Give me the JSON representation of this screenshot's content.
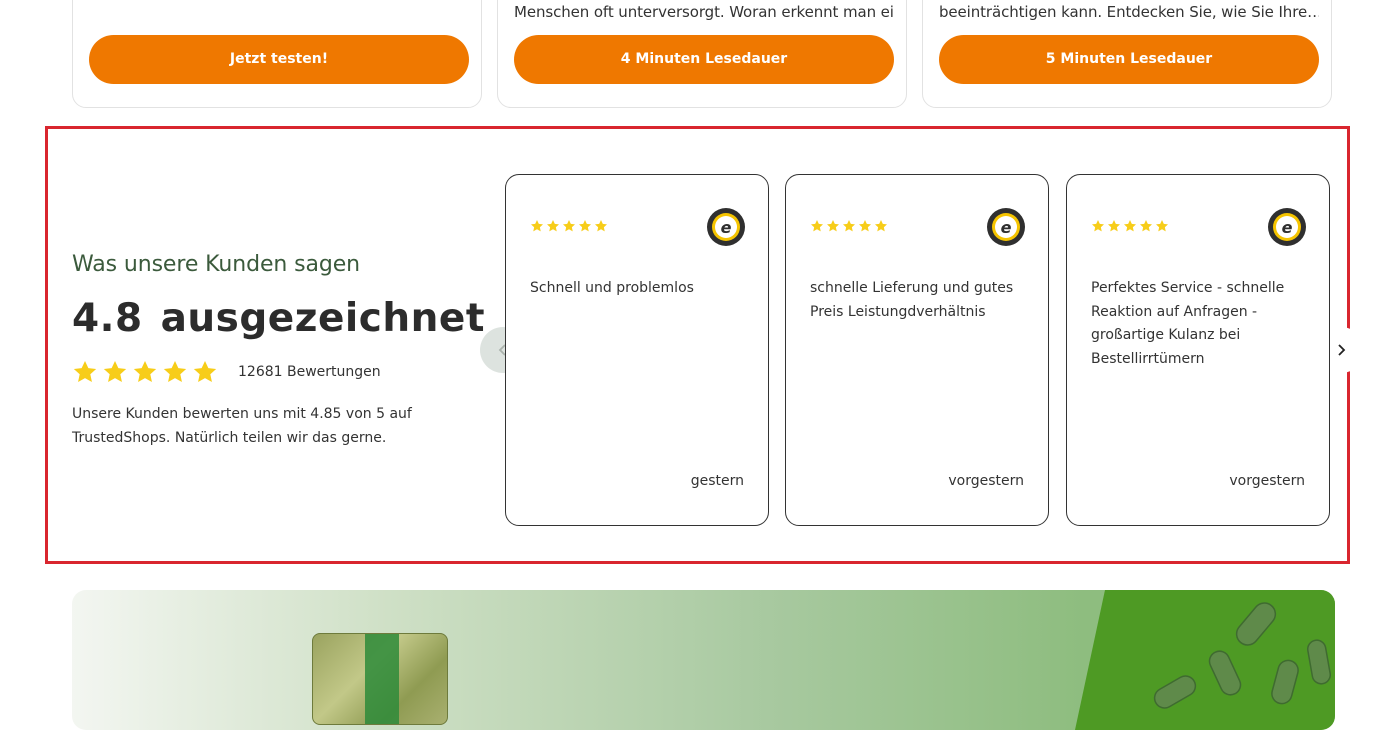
{
  "article_cards": [
    {
      "snippet": "",
      "cta": "Jetzt testen!"
    },
    {
      "snippet": "Menschen oft unterversorgt. Woran erkennt man eine…",
      "cta": "4 Minuten Lesedauer"
    },
    {
      "snippet": "beeinträchtigen kann. Entdecken Sie, wie Sie Ihre…",
      "cta": "5 Minuten Lesedauer"
    }
  ],
  "reviews_summary": {
    "heading": "Was unsere Kunden sagen",
    "score": "4.8",
    "rating_label": "ausgezeichnet",
    "stars": 5,
    "count_text": "12681 Bewertungen",
    "description": "Unsere Kunden bewerten uns mit 4.85 von 5 auf TrustedShops. Natürlich teilen wir das gerne."
  },
  "reviews": [
    {
      "stars": 5,
      "text": "Schnell und problemlos",
      "date": "gestern",
      "badge": "trusted-shops-seal-icon"
    },
    {
      "stars": 5,
      "text": "schnelle Lieferung und gutes Preis Leistungdverhältnis",
      "date": "vorgestern",
      "badge": "trusted-shops-seal-icon"
    },
    {
      "stars": 5,
      "text": "Perfektes Service - schnelle Reaktion auf Anfragen - großartige Kulanz bei Bestellirrtümern",
      "date": "vorgestern",
      "badge": "trusted-shops-seal-icon"
    }
  ],
  "carousel": {
    "prev_icon": "chevron-left-icon",
    "next_icon": "chevron-right-icon"
  },
  "colors": {
    "accent_orange": "#ef7800",
    "star_yellow": "#f7cd19",
    "heading_green": "#3b5a3c",
    "highlight_red": "#d9262f"
  }
}
